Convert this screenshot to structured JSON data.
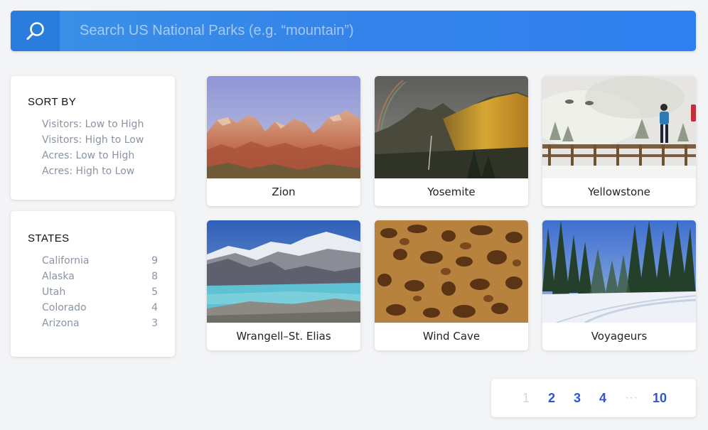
{
  "search": {
    "placeholder": "Search US National Parks (e.g. “mountain”)",
    "icon": "search-icon"
  },
  "sort": {
    "title": "SORT BY",
    "options": [
      "Visitors: Low to High",
      "Visitors: High to Low",
      "Acres: Low to High",
      "Acres: High to Low"
    ]
  },
  "states": {
    "title": "STATES",
    "items": [
      {
        "name": "California",
        "count": "9"
      },
      {
        "name": "Alaska",
        "count": "8"
      },
      {
        "name": "Utah",
        "count": "5"
      },
      {
        "name": "Colorado",
        "count": "4"
      },
      {
        "name": "Arizona",
        "count": "3"
      }
    ]
  },
  "parks": [
    {
      "name": "Zion"
    },
    {
      "name": "Yosemite"
    },
    {
      "name": "Yellowstone"
    },
    {
      "name": "Wrangell–St. Elias"
    },
    {
      "name": "Wind Cave"
    },
    {
      "name": "Voyageurs"
    }
  ],
  "pagination": {
    "pages": [
      "1",
      "2",
      "3",
      "4"
    ],
    "ellipsis": "···",
    "last": "10",
    "current": "1"
  },
  "colors": {
    "accent": "#3483ea",
    "link": "#2f55d4",
    "muted": "#8a94a6"
  }
}
